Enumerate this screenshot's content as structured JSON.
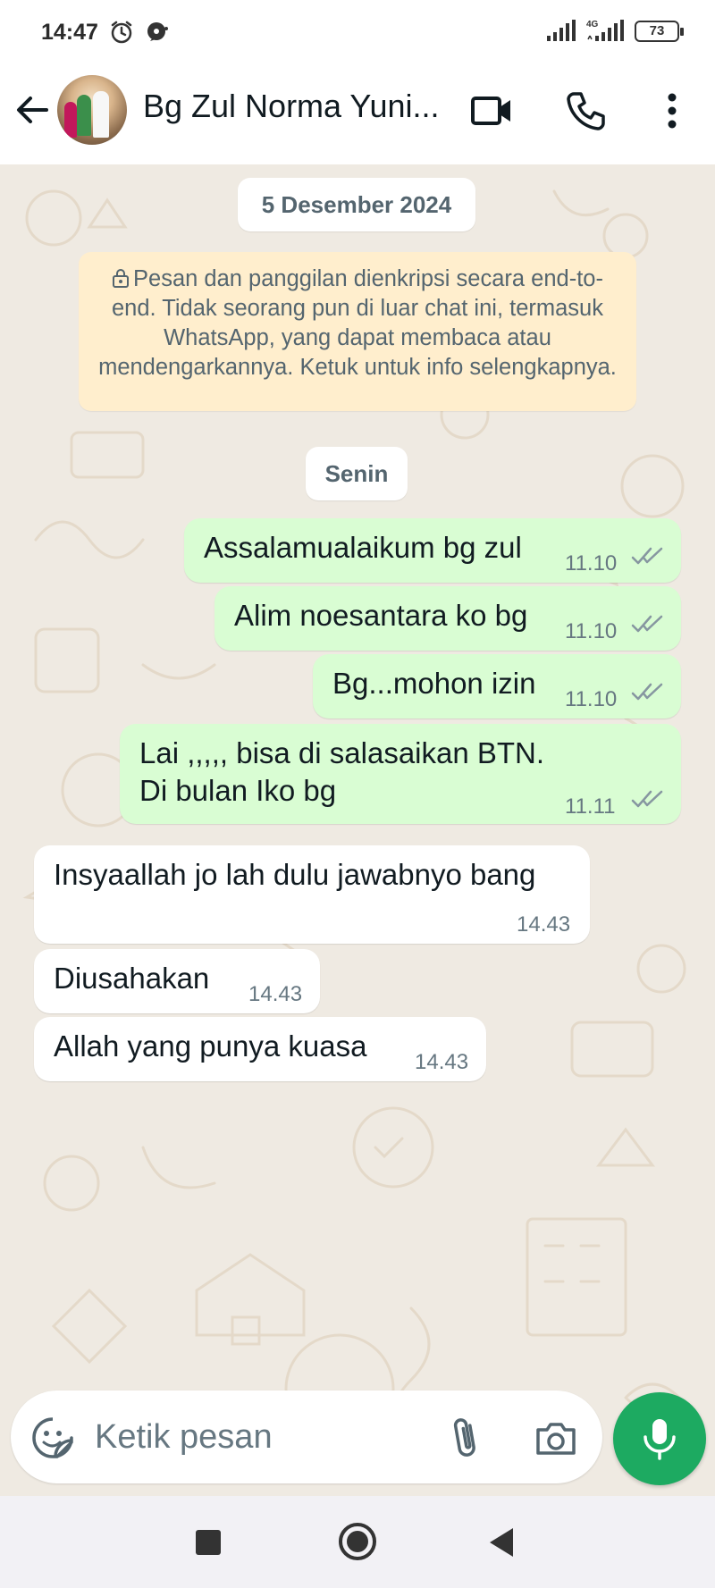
{
  "status_bar": {
    "time": "14:47",
    "network": "4G",
    "battery": "73"
  },
  "header": {
    "contact_name": "Bg Zul Norma Yuni..."
  },
  "chat": {
    "date_divider": "5 Desember 2024",
    "encryption_notice": "Pesan dan panggilan dienkripsi secara end-to-end. Tidak seorang pun di luar chat ini, termasuk WhatsApp, yang dapat membaca atau mendengarkannya. Ketuk untuk info selengkapnya.",
    "day_divider": "Senin",
    "messages": [
      {
        "direction": "outgoing",
        "text": "Assalamualaikum bg zul",
        "time": "11.10",
        "status": "read"
      },
      {
        "direction": "outgoing",
        "text": "Alim noesantara ko bg",
        "time": "11.10",
        "status": "read"
      },
      {
        "direction": "outgoing",
        "text": "Bg...mohon izin",
        "time": "11.10",
        "status": "read"
      },
      {
        "direction": "outgoing",
        "lines": [
          "Lai ,,,,, bisa di salasaikan BTN.",
          "Di bulan Iko bg"
        ],
        "time": "11.11",
        "status": "read"
      },
      {
        "direction": "incoming",
        "text": "Insyaallah jo lah dulu jawabnyo bang",
        "time": "14.43"
      },
      {
        "direction": "incoming",
        "text": "Diusahakan",
        "time": "14.43"
      },
      {
        "direction": "incoming",
        "text": "Allah yang punya kuasa",
        "time": "14.43"
      }
    ]
  },
  "composer": {
    "placeholder": "Ketik pesan"
  },
  "colors": {
    "outgoing_bubble": "#d9fdd3",
    "incoming_bubble": "#ffffff",
    "chat_background": "#efeae2",
    "notice_background": "#ffeecd",
    "accent": "#1daa61",
    "read_tick": "#8696a0"
  },
  "icons": [
    "alarm-icon",
    "messenger-icon",
    "signal-icon",
    "battery-icon",
    "back-arrow-icon",
    "video-call-icon",
    "phone-icon",
    "more-vertical-icon",
    "lock-icon",
    "double-check-icon",
    "sticker-icon",
    "paperclip-icon",
    "camera-icon",
    "mic-icon",
    "nav-recents-icon",
    "nav-home-icon",
    "nav-back-icon"
  ]
}
